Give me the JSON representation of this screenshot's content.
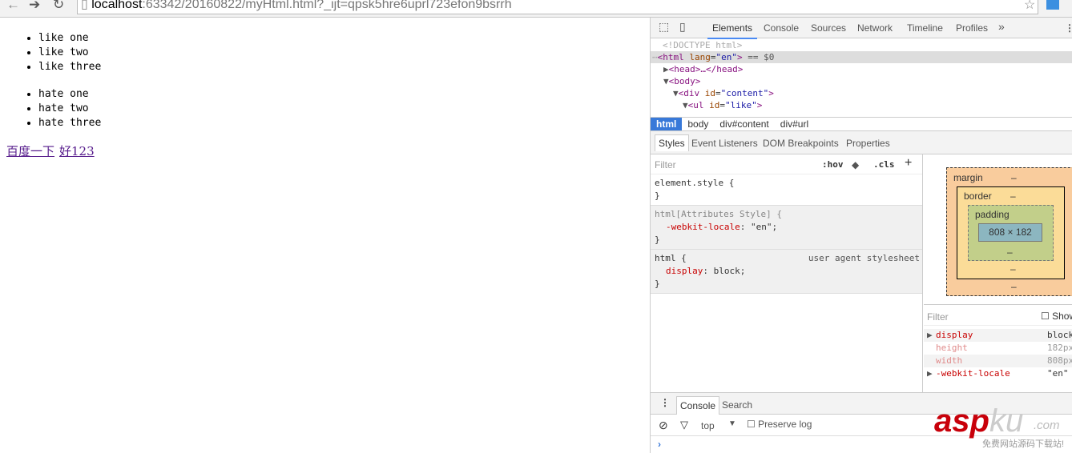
{
  "browser": {
    "url_host": "localhost",
    "url_rest": ":63342/20160822/myHtml.html?_ijt=qpsk5hre6uprl723efon9bsrrh"
  },
  "page": {
    "like_items": [
      "like one",
      "like two",
      "like three"
    ],
    "hate_items": [
      "hate one",
      "hate two",
      "hate three"
    ],
    "links": [
      "百度一下",
      "好123"
    ]
  },
  "devtools": {
    "tabs": [
      "Elements",
      "Console",
      "Sources",
      "Network",
      "Timeline",
      "Profiles"
    ],
    "more": "»",
    "dom": {
      "doctype": "<!DOCTYPE html>",
      "html_open": "<html",
      "lang_attr": "lang",
      "lang_val": "\"en\"",
      "selected_suffix": "== $0",
      "head": "<head>…</head>",
      "body": "<body>",
      "div": "<div",
      "div_attr": "id",
      "div_val": "\"content\"",
      "ul": "<ul",
      "ul_attr": "id",
      "ul_val": "\"like\""
    },
    "breadcrumbs": [
      "html",
      "body",
      "div#content",
      "div#url"
    ],
    "style_tabs": [
      "Styles",
      "Event Listeners",
      "DOM Breakpoints",
      "Properties"
    ],
    "filter_placeholder": "Filter",
    "hov": ":hov",
    "cls": ".cls",
    "add": "+",
    "rules": [
      {
        "selector": "element.style {",
        "props": [],
        "close": "}"
      },
      {
        "selector": "html[Attributes Style] {",
        "props": [
          {
            "name": "-webkit-locale",
            "value": "\"en\";"
          }
        ],
        "close": "}"
      },
      {
        "selector": "html {",
        "source": "user agent stylesheet",
        "props": [
          {
            "name": "display",
            "value": "block;"
          }
        ],
        "close": "}"
      }
    ],
    "box_model": {
      "margin": "margin",
      "border": "border",
      "padding": "padding",
      "dash": "–",
      "content": "808 × 182"
    },
    "computed": {
      "filter": "Filter",
      "show_all": "Show all",
      "props": [
        {
          "name": "display",
          "value": "block",
          "inherited": false
        },
        {
          "name": "height",
          "value": "182px",
          "inherited": true
        },
        {
          "name": "width",
          "value": "808px",
          "inherited": true
        },
        {
          "name": "-webkit-locale",
          "value": "\"en\"",
          "inherited": false
        }
      ]
    },
    "drawer": {
      "tabs": [
        "Console",
        "Search"
      ],
      "context": "top",
      "preserve_log": "Preserve log",
      "prompt": "›"
    }
  },
  "watermark": {
    "brand": "aspku",
    "tld": ".com",
    "slogan": "免费网站源码下载站!"
  }
}
